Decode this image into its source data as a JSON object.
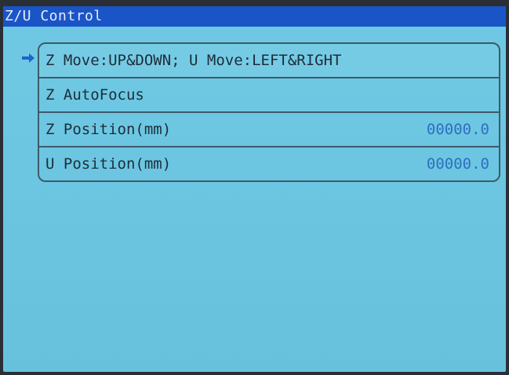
{
  "window": {
    "title": "Z/U Control"
  },
  "menu": {
    "items": [
      {
        "label": "Z Move:UP&DOWN; U Move:LEFT&RIGHT",
        "value": ""
      },
      {
        "label": "Z AutoFocus",
        "value": ""
      },
      {
        "label": "Z Position(mm)",
        "value": "00000.0"
      },
      {
        "label": "U Position(mm)",
        "value": "00000.0"
      }
    ],
    "selected_index": 0
  },
  "colors": {
    "title_bar": "#1a55c8",
    "screen_bg": "#6cc6e1",
    "value_text": "#2f6fc2",
    "cursor": "#1f63c9"
  },
  "icons": {
    "cursor": "arrow-right-icon"
  }
}
